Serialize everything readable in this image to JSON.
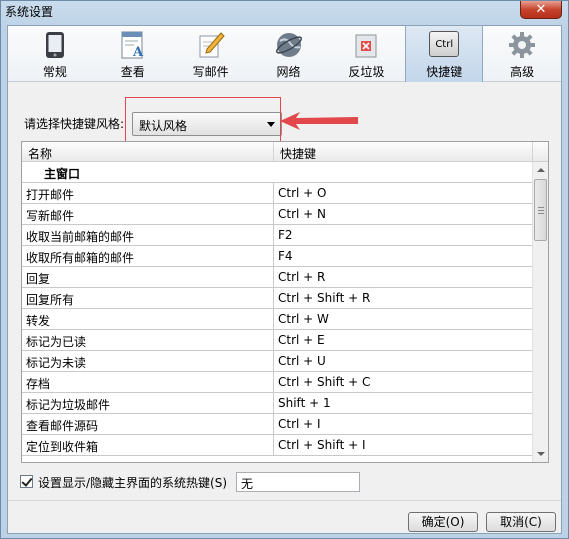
{
  "window": {
    "title": "系统设置",
    "close_glyph": "✕"
  },
  "toolbar": {
    "items": [
      {
        "label": "常规",
        "icon": "phone-icon"
      },
      {
        "label": "查看",
        "icon": "document-view-icon"
      },
      {
        "label": "写邮件",
        "icon": "pencil-icon"
      },
      {
        "label": "网络",
        "icon": "globe-icon"
      },
      {
        "label": "反垃圾",
        "icon": "trash-icon"
      },
      {
        "label": "快捷键",
        "icon": "ctrl-key-icon",
        "icon_text": "Ctrl",
        "active": true
      },
      {
        "label": "高级",
        "icon": "gear-icon"
      }
    ]
  },
  "style_selector": {
    "label": "请选择快捷键风格:",
    "value": "默认风格"
  },
  "table": {
    "headers": {
      "name": "名称",
      "shortcut": "快捷键"
    },
    "section": "主窗口",
    "rows": [
      {
        "name": "打开邮件",
        "key": "Ctrl + O"
      },
      {
        "name": "写新邮件",
        "key": "Ctrl + N"
      },
      {
        "name": "收取当前邮箱的邮件",
        "key": "F2"
      },
      {
        "name": "收取所有邮箱的邮件",
        "key": "F4"
      },
      {
        "name": "回复",
        "key": "Ctrl + R"
      },
      {
        "name": "回复所有",
        "key": "Ctrl + Shift + R"
      },
      {
        "name": "转发",
        "key": "Ctrl + W"
      },
      {
        "name": "标记为已读",
        "key": "Ctrl + E"
      },
      {
        "name": "标记为未读",
        "key": "Ctrl + U"
      },
      {
        "name": "存档",
        "key": "Ctrl + Shift + C"
      },
      {
        "name": "标记为垃圾邮件",
        "key": "Shift + 1"
      },
      {
        "name": "查看邮件源码",
        "key": "Ctrl + I"
      },
      {
        "name": "定位到收件箱",
        "key": "Ctrl + Shift + I"
      }
    ]
  },
  "hotkey": {
    "label": "设置显示/隐藏主界面的系统热键(S)",
    "checked": true,
    "value": "无"
  },
  "buttons": {
    "ok": "确定(O)",
    "cancel": "取消(C)"
  },
  "colors": {
    "highlight": "#e2474c",
    "active_tab": "#c3d6ea"
  }
}
